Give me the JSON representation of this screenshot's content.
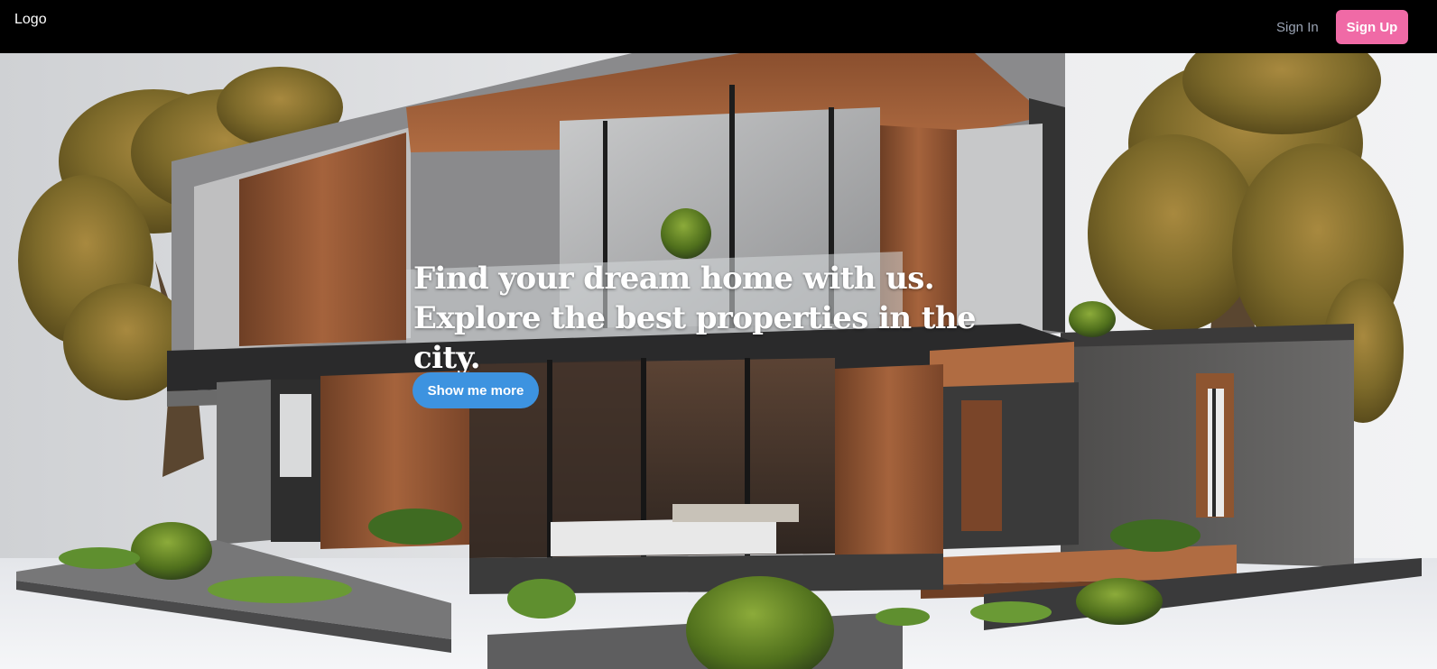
{
  "header": {
    "logo": "Logo",
    "signin_label": "Sign In",
    "signup_label": "Sign Up"
  },
  "hero": {
    "headline": "Find your dream home with us. Explore the best properties in the city.",
    "cta_label": "Show me more",
    "image_icon": "modern-house-photo"
  },
  "colors": {
    "header_bg": "#000000",
    "signup_bg": "#f06aa6",
    "cta_bg": "#3d93e0",
    "signin_text": "#9aa3b3"
  }
}
